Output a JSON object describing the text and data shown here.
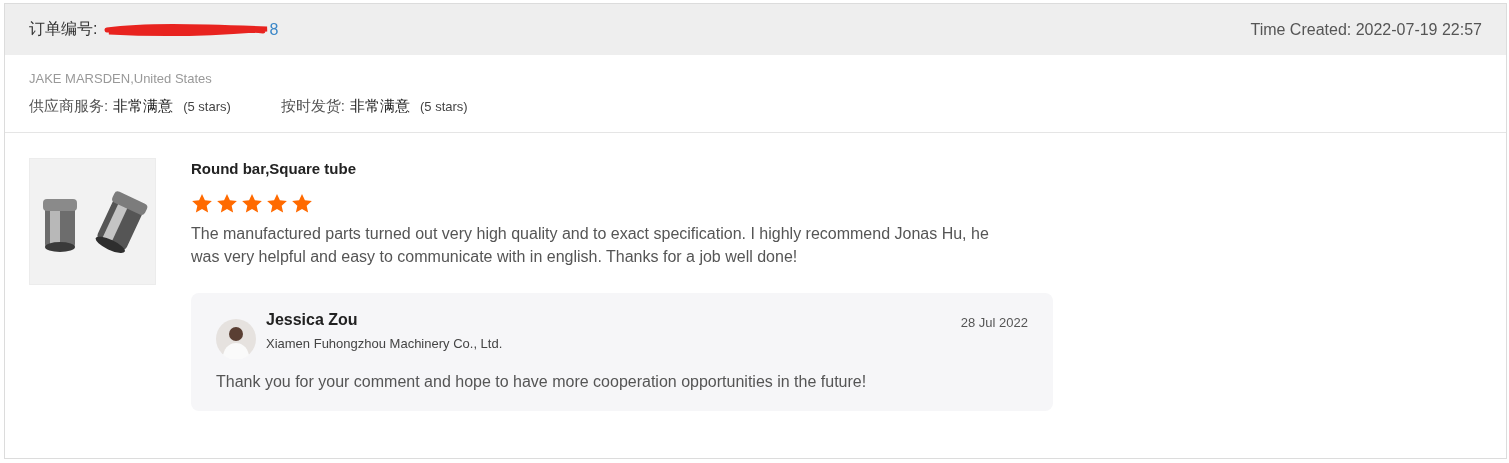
{
  "order": {
    "label": "订单编号:",
    "number_visible": "8",
    "redacted": true,
    "time_created": "Time Created: 2022-07-19 22:57"
  },
  "buyer": {
    "name": "JAKE MARSDEN,United States"
  },
  "ratings": [
    {
      "label": "供应商服务:",
      "value": "非常满意",
      "stars_text": "(5 stars)"
    },
    {
      "label": "按时发货:",
      "value": "非常满意",
      "stars_text": "(5 stars)"
    }
  ],
  "review": {
    "product": "Round bar,Square tube",
    "stars": 5,
    "text": "The manufactured parts turned out very high quality and to exact specification. I highly recommend Jonas Hu, he was very helpful and easy to communicate with in english. Thanks for a job well done!",
    "reply": {
      "name": "Jessica Zou",
      "company": "Xiamen Fuhongzhou Machinery Co., Ltd.",
      "date": "28 Jul 2022",
      "text": "Thank you for your comment and hope to have more cooperation opportunities in the future!"
    }
  }
}
